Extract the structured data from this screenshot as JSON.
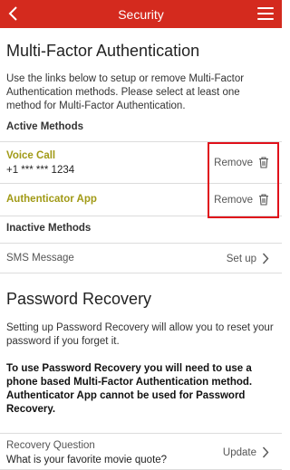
{
  "header": {
    "title": "Security"
  },
  "mfa": {
    "title": "Multi-Factor Authentication",
    "description": "Use the links below to setup or remove Multi-Factor Authentication methods. Please select at least one method for Multi-Factor Authentication.",
    "active_label": "Active Methods",
    "active_methods": [
      {
        "name": "Voice Call",
        "detail": "+1 *** *** 1234",
        "action": "Remove"
      },
      {
        "name": "Authenticator App",
        "action": "Remove"
      }
    ],
    "inactive_label": "Inactive Methods",
    "inactive_methods": [
      {
        "name": "SMS Message",
        "action": "Set up"
      }
    ]
  },
  "recovery": {
    "title": "Password Recovery",
    "description": "Setting up Password Recovery will allow you to reset your password if you forget it.",
    "note": "To use Password Recovery you will need to use a phone based Multi-Factor Authentication method. Authenticator App cannot be used for Password Recovery.",
    "question_label": "Recovery Question",
    "question_value": "What is your favorite movie quote?",
    "question_action": "Update"
  },
  "colors": {
    "header": "#d42a1e",
    "active_method": "#a19a16",
    "highlight": "#e0101a"
  }
}
